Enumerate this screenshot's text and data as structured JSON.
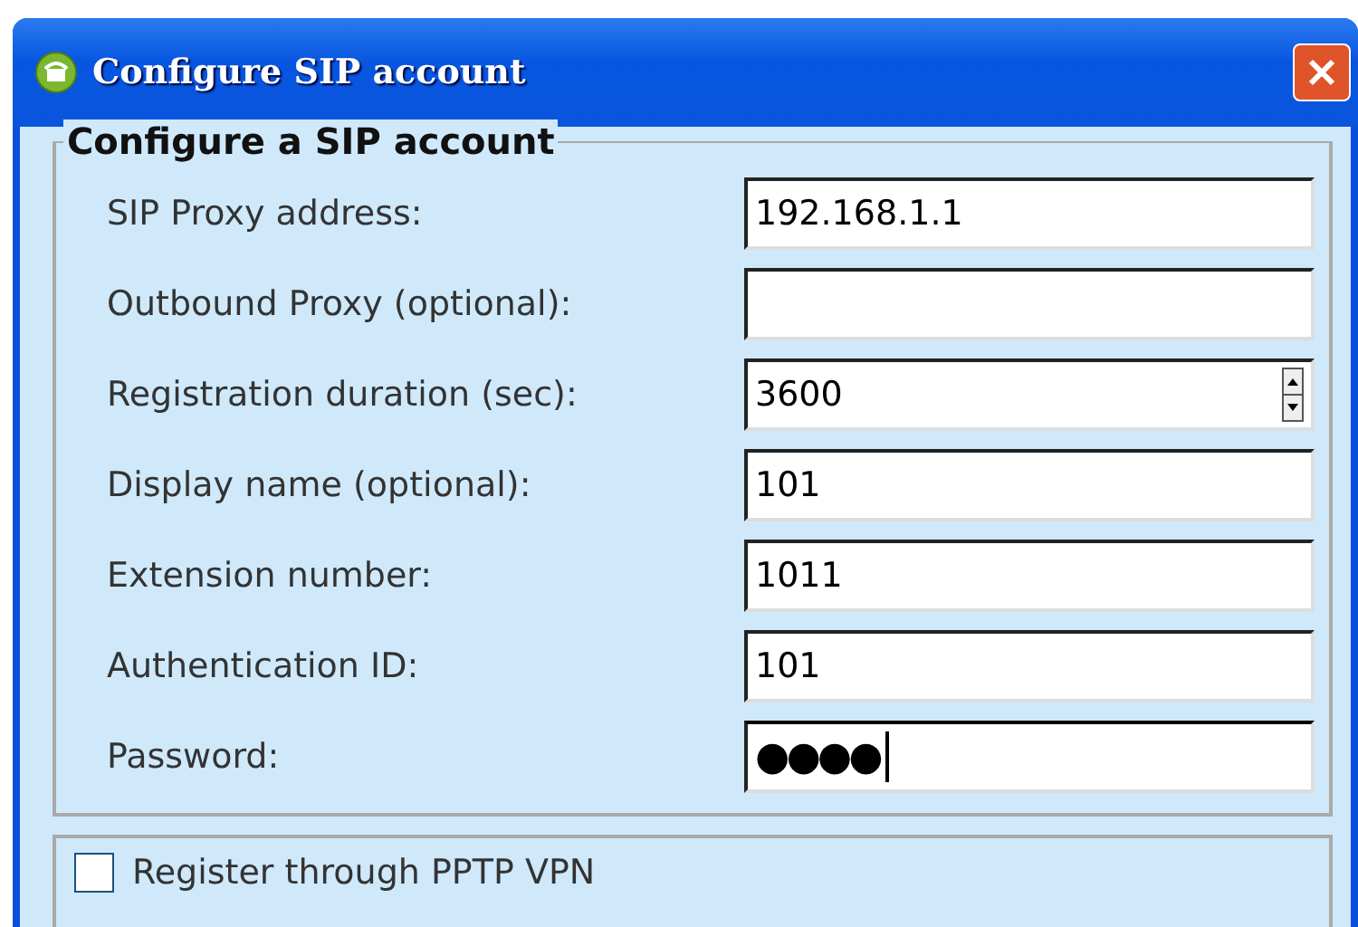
{
  "window": {
    "title": "Configure SIP account"
  },
  "group": {
    "title": "Configure a SIP account"
  },
  "fields": [
    {
      "label": "SIP Proxy address:",
      "kind": "text",
      "value": "192.168.1.1",
      "focused": false
    },
    {
      "label": "Outbound Proxy (optional):",
      "kind": "text",
      "focused": false
    },
    {
      "label": "Registration duration (sec):",
      "kind": "spin",
      "value": "3600",
      "focused": false
    },
    {
      "label": "Display name (optional):",
      "kind": "text",
      "value": "101",
      "focused": false
    },
    {
      "label": "Extension number:",
      "kind": "text",
      "value": "1011",
      "focused": false
    },
    {
      "label": "Authentication ID:",
      "kind": "text",
      "value": "101",
      "focused": false
    },
    {
      "label": "Password:",
      "kind": "password",
      "value": "●●●●",
      "focused": true
    }
  ],
  "options": [
    {
      "label": "Register through PPTP VPN",
      "checked": false
    }
  ]
}
